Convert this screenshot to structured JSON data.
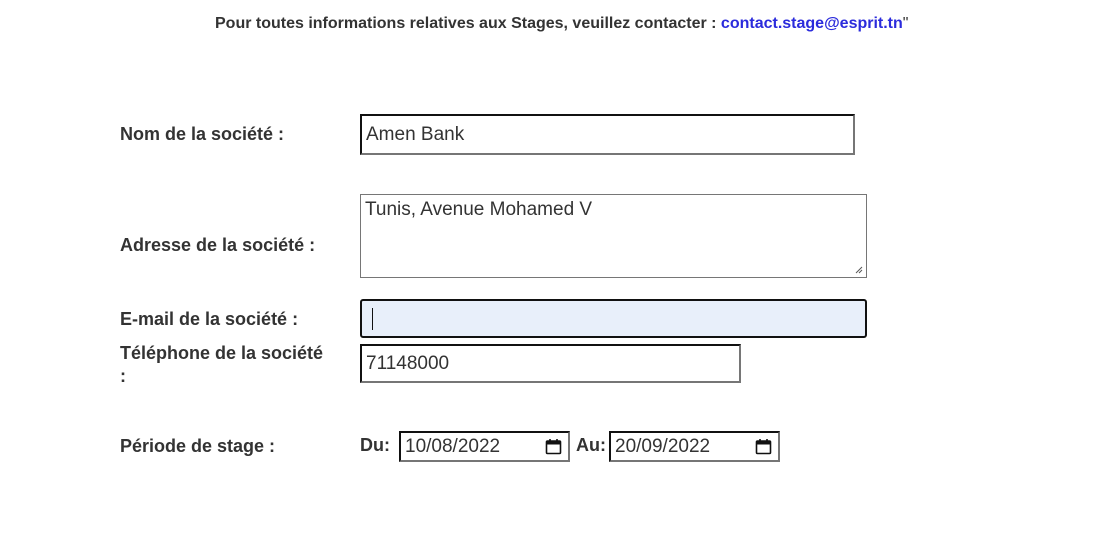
{
  "notice": {
    "text": "Pour toutes informations relatives aux Stages, veuillez contacter : ",
    "email": "contact.stage@esprit.tn",
    "quote": "\""
  },
  "form": {
    "company_name": {
      "label": "Nom de la société  :",
      "value": "Amen Bank"
    },
    "company_address": {
      "label": "Adresse de la société  :",
      "value": "Tunis, Avenue Mohamed V"
    },
    "company_email": {
      "label": "E-mail de la société  :",
      "value": ""
    },
    "company_phone": {
      "label_line1": "Téléphone de la société",
      "label_line2": ":",
      "value": "71148000"
    },
    "internship_period": {
      "label": "Période de stage :",
      "from_label": "Du:",
      "from_value": "10/08/2022",
      "to_label": "Au:",
      "to_value": "20/09/2022"
    }
  },
  "icons": {
    "calendar": "calendar-icon",
    "resize": "resize-handle-icon"
  }
}
